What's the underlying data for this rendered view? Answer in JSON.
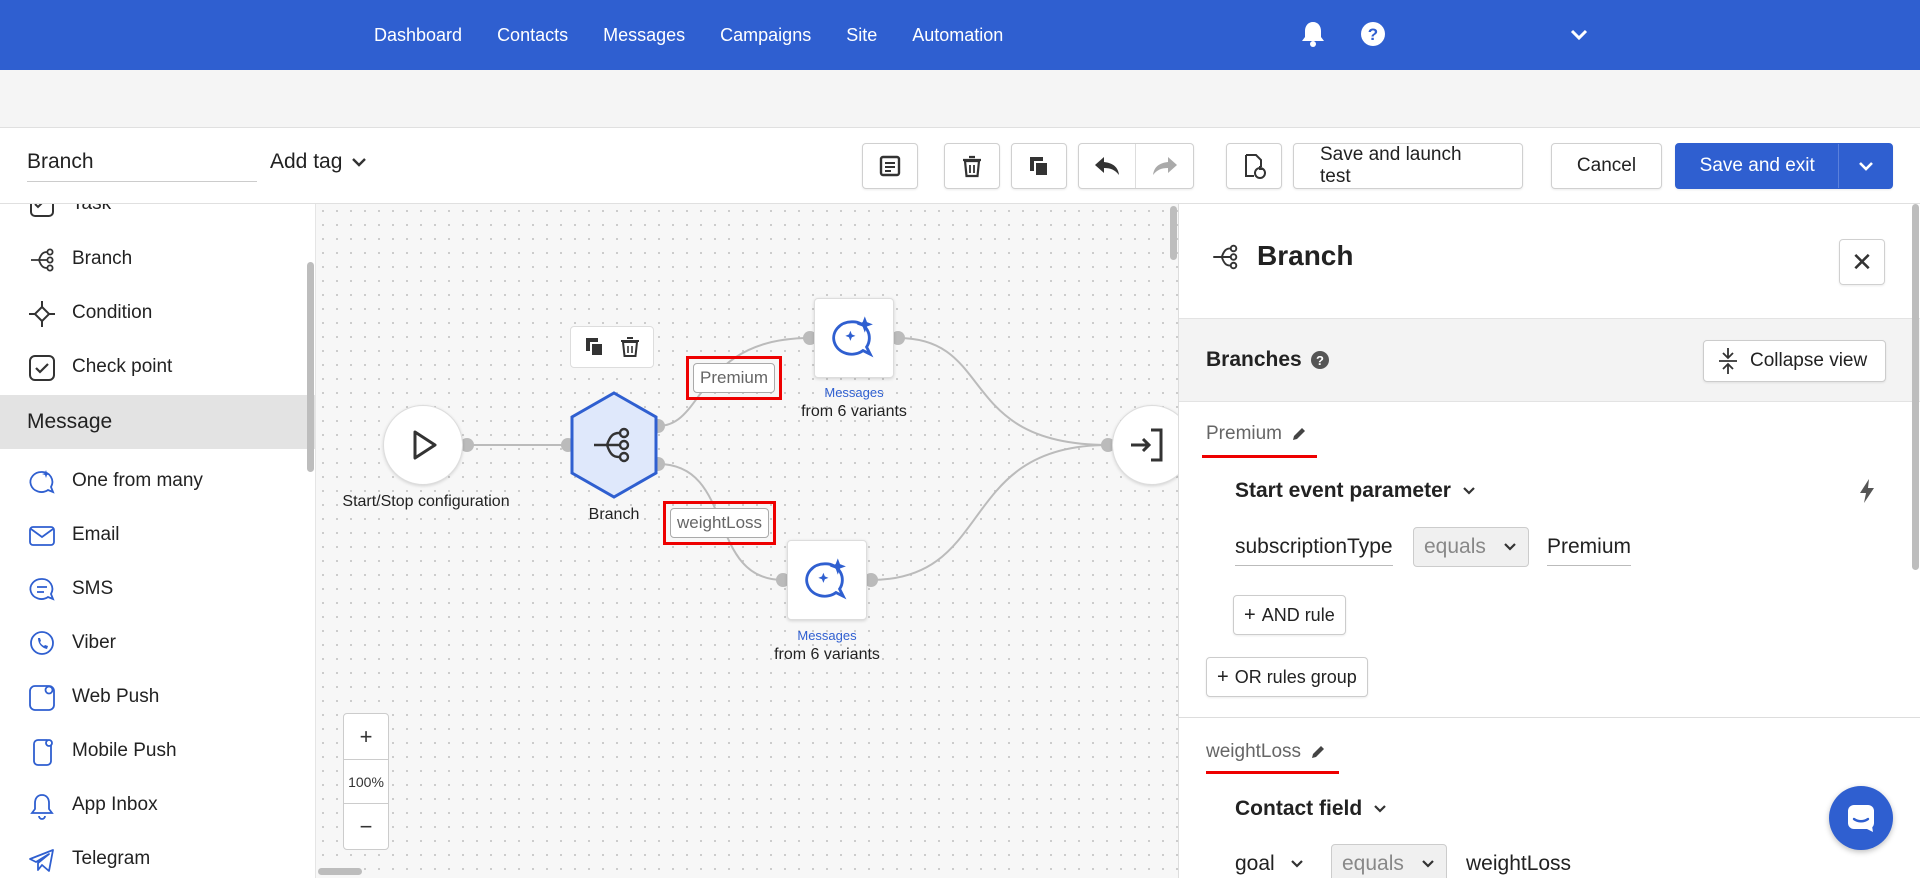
{
  "nav": {
    "links": [
      "Dashboard",
      "Contacts",
      "Messages",
      "Campaigns",
      "Site",
      "Automation"
    ]
  },
  "toolbar": {
    "title": "Branch",
    "add_tag": "Add tag",
    "save_test": "Save and launch test",
    "cancel": "Cancel",
    "save_exit": "Save and exit"
  },
  "sidebar": {
    "partial_item": "Task",
    "items_top": [
      "Branch",
      "Condition",
      "Check point"
    ],
    "section": "Message",
    "items_message": [
      "One from many",
      "Email",
      "SMS",
      "Viber",
      "Web Push",
      "Mobile Push",
      "App Inbox",
      "Telegram"
    ]
  },
  "canvas": {
    "start_label": "Start/Stop configuration",
    "branch_label": "Branch",
    "msg_top_title": "Messages",
    "msg_top_sub": "from 6 variants",
    "msg_bottom_title": "Messages",
    "msg_bottom_sub": "from 6 variants",
    "tag_premium": "Premium",
    "tag_weightloss": "weightLoss",
    "zoom_in": "+",
    "zoom_level": "100%",
    "zoom_out": "−"
  },
  "panel": {
    "title": "Branch",
    "close": "✕",
    "section_title": "Branches",
    "collapse": "Collapse view",
    "branch1": {
      "name": "Premium",
      "condition": "Start event parameter",
      "field": "subscriptionType",
      "operator": "equals",
      "value": "Premium",
      "and_rule": "AND rule",
      "or_group": "OR rules group"
    },
    "branch2": {
      "name": "weightLoss",
      "condition": "Contact field",
      "field": "goal",
      "operator": "equals",
      "value": "weightLoss"
    }
  },
  "colors": {
    "brand": "#2f5fd0",
    "highlight": "#e00000"
  }
}
